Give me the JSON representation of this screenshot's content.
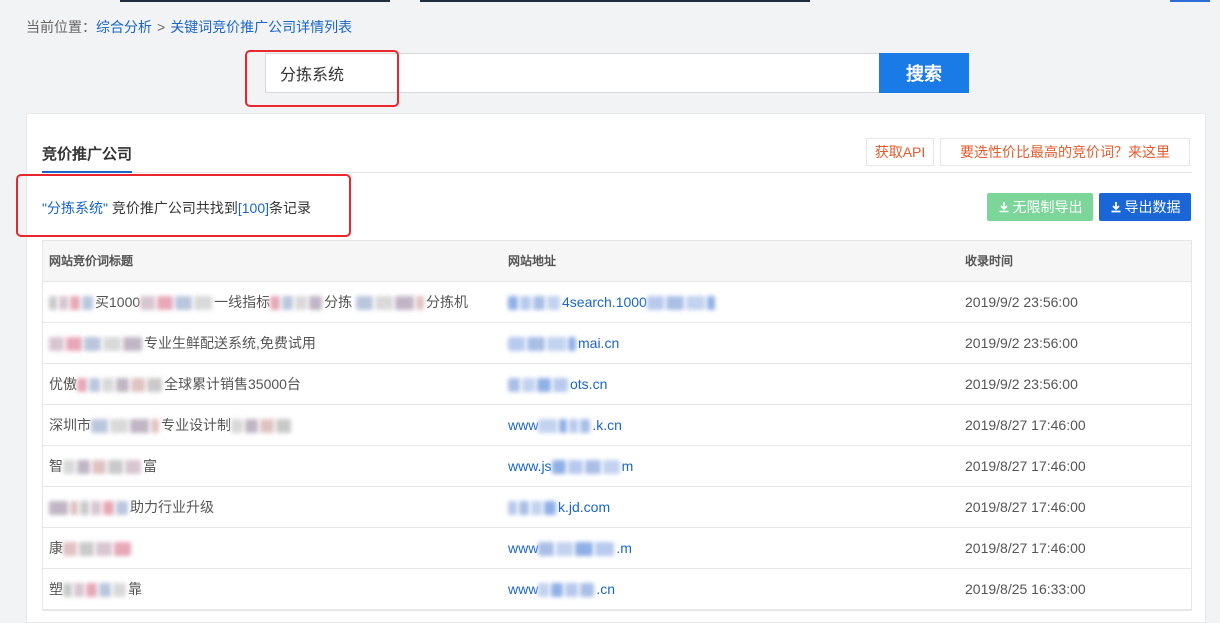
{
  "breadcrumb": {
    "prefix": "当前位置：",
    "link1": "综合分析",
    "separator": ">",
    "link2": "关键词竞价推广公司详情列表"
  },
  "search": {
    "value": "分拣系统",
    "button_label": "搜索"
  },
  "panel": {
    "tab_label": "竞价推广公司",
    "api_button": "获取API",
    "promo_button": "要选性价比最高的竞价词？来这里"
  },
  "summary": {
    "quote_open": "\"",
    "keyword": "分拣系统",
    "quote_close": "\"",
    "middle": " 竞价推广公司共找到",
    "bracket_open": "[",
    "count": "100",
    "bracket_close": "]",
    "suffix": "条记录"
  },
  "export": {
    "unlimited_label": "无限制导出",
    "data_label": "导出数据"
  },
  "table": {
    "headers": [
      "网站竞价词标题",
      "网站地址",
      "收录时间"
    ],
    "rows": [
      {
        "title_visible": "...买1000...一线指标...分拣 ...分拣机",
        "url_visible": "...4search.1000...",
        "time": "2019/9/2 23:56:00"
      },
      {
        "title_visible": "...专业生鲜配送系统,免费试用",
        "url_visible": "...mai.cn",
        "time": "2019/9/2 23:56:00"
      },
      {
        "title_visible": "优傲...全球累计销售35000台",
        "url_visible": "...ots.cn",
        "time": "2019/9/2 23:56:00"
      },
      {
        "title_visible": "深圳市...专业设计制...",
        "url_visible": "www....k.cn",
        "time": "2019/8/27 17:46:00"
      },
      {
        "title_visible": "智...富",
        "url_visible": "www.js...m",
        "time": "2019/8/27 17:46:00"
      },
      {
        "title_visible": "...助力行业升级",
        "url_visible": "...k.jd.com",
        "time": "2019/8/27 17:46:00"
      },
      {
        "title_visible": "康...",
        "url_visible": "www....m",
        "time": "2019/8/27 17:46:00"
      },
      {
        "title_visible": "塑...靠",
        "url_visible": "www....cn",
        "time": "2019/8/25 16:33:00"
      }
    ]
  },
  "colors": {
    "accent_blue": "#1a66c6",
    "search_button": "#1a7ae6",
    "export_green": "#7cd69a",
    "export_blue": "#1a66d6",
    "annotation_red": "#e8262b",
    "orange_text": "#e65a2b"
  },
  "icons": {
    "export_unlimited": "download-icon",
    "export_data": "download-icon"
  }
}
